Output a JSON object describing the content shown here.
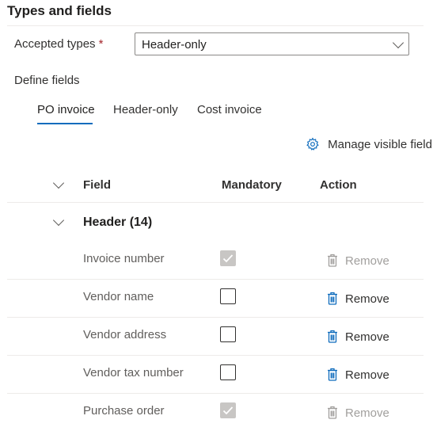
{
  "section": {
    "title": "Types and fields"
  },
  "accepted_types": {
    "label": "Accepted types",
    "required_marker": "*",
    "value": "Header-only"
  },
  "define_fields": {
    "label": "Define fields"
  },
  "tabs": [
    {
      "label": "PO invoice",
      "selected": true
    },
    {
      "label": "Header-only",
      "selected": false
    },
    {
      "label": "Cost invoice",
      "selected": false
    }
  ],
  "manage_visible_fields": {
    "label": "Manage visible field",
    "icon": "gear-icon"
  },
  "table": {
    "columns": {
      "field": "Field",
      "mandatory": "Mandatory",
      "action": "Action"
    },
    "group": {
      "label": "Header (14)"
    },
    "rows": [
      {
        "field": "Invoice number",
        "mandatory": true,
        "mandatory_disabled": true,
        "action": "Remove",
        "action_enabled": false
      },
      {
        "field": "Vendor name",
        "mandatory": false,
        "mandatory_disabled": false,
        "action": "Remove",
        "action_enabled": true
      },
      {
        "field": "Vendor address",
        "mandatory": false,
        "mandatory_disabled": false,
        "action": "Remove",
        "action_enabled": true
      },
      {
        "field": "Vendor tax number",
        "mandatory": false,
        "mandatory_disabled": false,
        "action": "Remove",
        "action_enabled": true
      },
      {
        "field": "Purchase order",
        "mandatory": true,
        "mandatory_disabled": true,
        "action": "Remove",
        "action_enabled": false
      }
    ]
  },
  "colors": {
    "accent": "#0f6cbd",
    "required": "#a4262c",
    "disabled_text": "#a19f9d",
    "disabled_checkbox": "#c8c6c4",
    "divider": "#edebe9"
  }
}
